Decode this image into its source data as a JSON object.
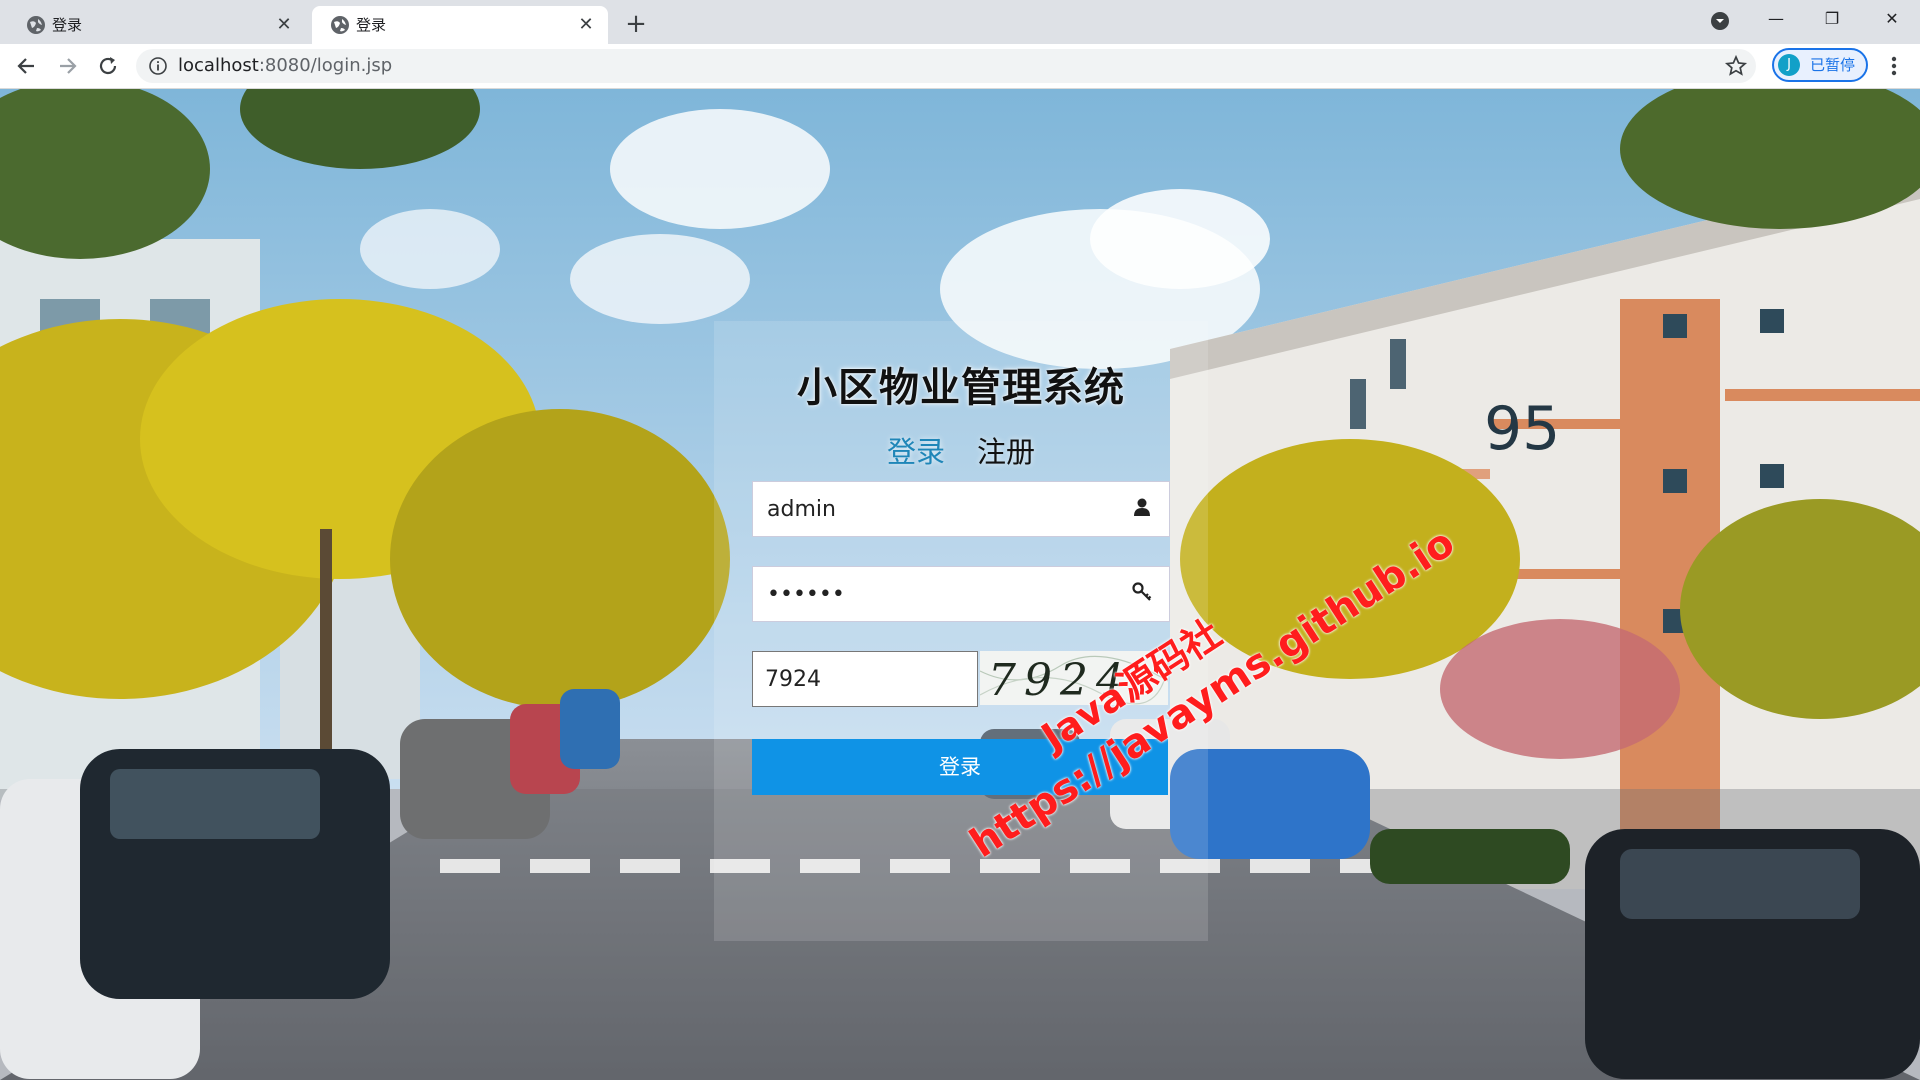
{
  "browser": {
    "tabs": [
      {
        "title": "登录",
        "active": false
      },
      {
        "title": "登录",
        "active": true
      }
    ],
    "new_tab_label": "+",
    "url_host": "localhost",
    "url_rest": ":8080/login.jsp",
    "profile_initial": "J",
    "profile_label": "已暂停"
  },
  "login": {
    "system_title": "小区物业管理系统",
    "tab_login": "登录",
    "tab_register": "注册",
    "username_value": "admin",
    "password_value": "••••••",
    "captcha_value": "7924",
    "captcha_image_text": "7924",
    "submit_label": "登录"
  },
  "watermark": {
    "line1": "Java源码社",
    "line2": "https://javayms.github.io"
  },
  "colors": {
    "accent_link": "#1f86b8",
    "button": "#0f93e6",
    "watermark": "#ff1d1d"
  }
}
